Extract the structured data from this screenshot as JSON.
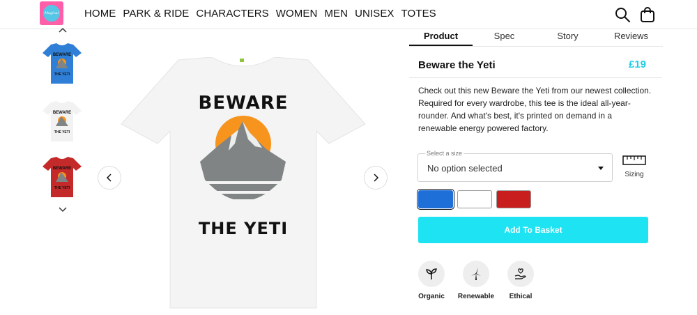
{
  "brand": {
    "logo_text": "Magical"
  },
  "nav": {
    "items": [
      "HOME",
      "PARK & RIDE",
      "CHARACTERS",
      "WOMEN",
      "MEN",
      "UNISEX",
      "TOTES"
    ]
  },
  "header_icons": [
    "search-icon",
    "shopping-bag-icon"
  ],
  "gallery": {
    "thumbnails": [
      {
        "color_name": "blue",
        "color": "#2f7fd6"
      },
      {
        "color_name": "white",
        "color": "#f2f2f2"
      },
      {
        "color_name": "red",
        "color": "#c52a2a"
      }
    ],
    "main": {
      "shirt_color": "#f4f4f4",
      "print_top": "BEWARE",
      "print_bottom": "THE YETI",
      "sun_color": "#f7941d",
      "mountain_color": "#808484"
    }
  },
  "tabs": [
    "Product",
    "Spec",
    "Story",
    "Reviews"
  ],
  "active_tab": "Product",
  "product": {
    "title": "Beware the Yeti",
    "price": "£19",
    "price_color": "#1ecde6",
    "description": "Check out this new Beware the Yeti from our newest collection. Required for every wardrobe, this tee is the ideal all-year-rounder. And what's best, it's printed on demand in a renewable energy powered factory."
  },
  "size_select": {
    "label": "Select a size",
    "value": "No option selected"
  },
  "sizing_label": "Sizing",
  "colors": [
    {
      "name": "blue",
      "hex": "#1f6fd9",
      "selected": true
    },
    {
      "name": "white",
      "hex": "#ffffff",
      "selected": false
    },
    {
      "name": "red",
      "hex": "#c81e1e",
      "selected": false
    }
  ],
  "add_to_basket": "Add To Basket",
  "add_button_color": "#1ee3f2",
  "badges": [
    {
      "label": "Organic",
      "icon": "sprout-icon"
    },
    {
      "label": "Renewable",
      "icon": "wind-turbine-icon"
    },
    {
      "label": "Ethical",
      "icon": "heart-hand-icon"
    }
  ]
}
